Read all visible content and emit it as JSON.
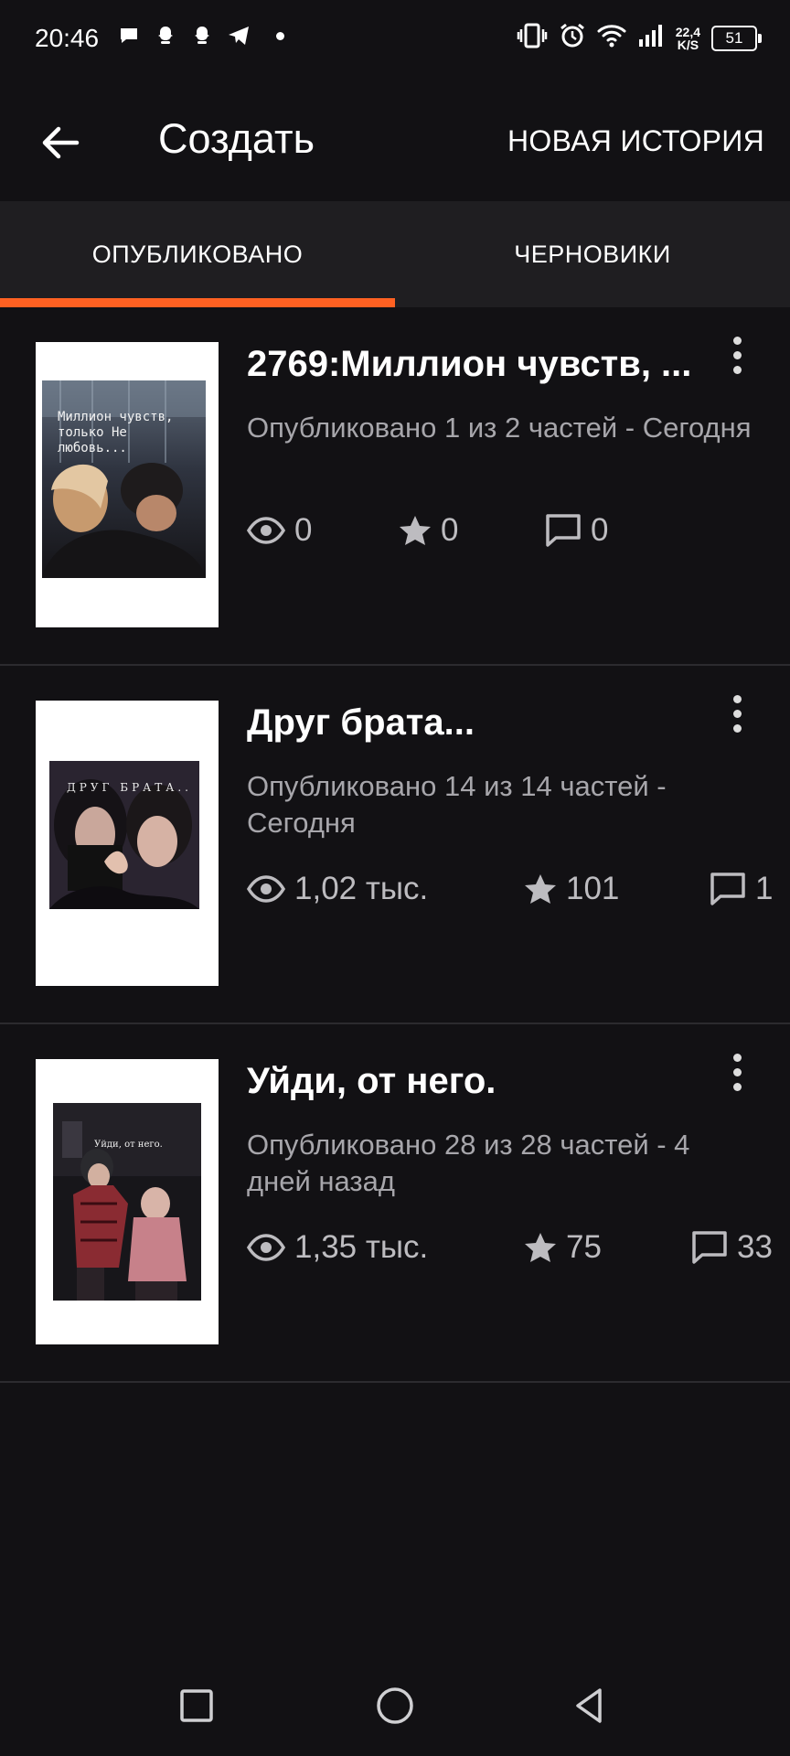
{
  "status_bar": {
    "time": "20:46",
    "speed_value": "22,4",
    "speed_unit": "K/S",
    "battery": "51",
    "icons": [
      "chat-icon",
      "snapchat-icon",
      "snapchat-icon",
      "telegram-icon",
      "vibrate-icon",
      "alarm-icon",
      "wifi-icon",
      "signal-icon"
    ]
  },
  "app_bar": {
    "title": "Создать",
    "action": "НОВАЯ ИСТОРИЯ"
  },
  "tabs": [
    {
      "label": "ОПУБЛИКОВАНО",
      "active": true
    },
    {
      "label": "ЧЕРНОВИКИ",
      "active": false
    }
  ],
  "stories": [
    {
      "title": "2769:Миллион чувств, ...",
      "published": "Опубликовано 1 из 2 частей - Сегодня",
      "reads": "0",
      "votes": "0",
      "comments": "0",
      "cover_text": "Миллион чувств, только Не любовь..."
    },
    {
      "title": "Друг брата...",
      "published": "Опубликовано 14 из 14 частей - Сегодня",
      "reads": "1,02 тыс.",
      "votes": "101",
      "comments": "1",
      "cover_text": "ДРУГ БРАТА.."
    },
    {
      "title": "Уйди, от него.",
      "published": "Опубликовано 28 из 28 частей - 4 дней назад",
      "reads": "1,35 тыс.",
      "votes": "75",
      "comments": "33",
      "cover_text": "Уйди, от него."
    }
  ],
  "colors": {
    "accent": "#ff6122",
    "background": "#121114",
    "tab_bar": "#1f1e21"
  }
}
